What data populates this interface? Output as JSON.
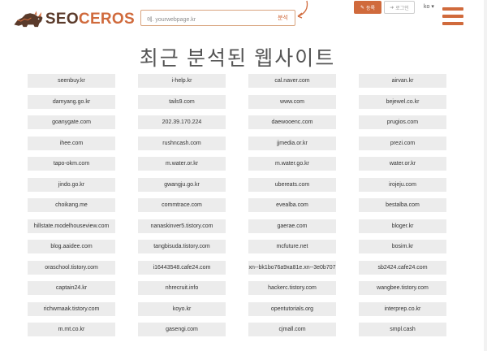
{
  "header": {
    "logo_prefix": "SEO",
    "logo_suffix": "CEROS",
    "search_placeholder": "예. yourwebpage.kr",
    "search_button": "분석",
    "register_label": "등록",
    "login_label": "로그인",
    "language": "ko",
    "colors": {
      "accent": "#d06a3c",
      "brand_dark": "#5a3a2a"
    }
  },
  "page": {
    "title": "최근 분석된 웹사이트"
  },
  "sites": [
    "seenbuy.kr",
    "i-help.kr",
    "cal.naver.com",
    "airvan.kr",
    "damyang.go.kr",
    "tails9.com",
    "www.com",
    "bejewel.co.kr",
    "goanygate.com",
    "202.39.170.224",
    "daewooenc.com",
    "prugios.com",
    "ihee.com",
    "rushncash.com",
    "jjmedia.or.kr",
    "prezi.com",
    "tapo-okm.com",
    "m.water.or.kr",
    "m.water.go.kr",
    "water.or.kr",
    "jindo.go.kr",
    "gwangju.go.kr",
    "ubereats.com",
    "irojeju.com",
    "choikang.me",
    "commtrace.com",
    "evealba.com",
    "bestalba.com",
    "hillstate.modelhouseview.com",
    "nanaskinver5.tistory.com",
    "gaerae.com",
    "bloger.kr",
    "blog.aaidee.com",
    "tangbisuda.tistory.com",
    "mcfuture.net",
    "bosim.kr",
    "oraschool.tistory.com",
    "i16443548.cafe24.com",
    "xn--bk1bo76a9xa81e.xn--3e0b707",
    "sb2424.cafe24.com",
    "captain24.kr",
    "nhrecruit.info",
    "hackerc.tistory.com",
    "wangbee.tistory.com",
    "richwmaak.tistory.com",
    "koyo.kr",
    "opentutorials.org",
    "interprep.co.kr",
    "m.mt.co.kr",
    "gasengi.com",
    "cjmall.com",
    "smpl.cash"
  ]
}
